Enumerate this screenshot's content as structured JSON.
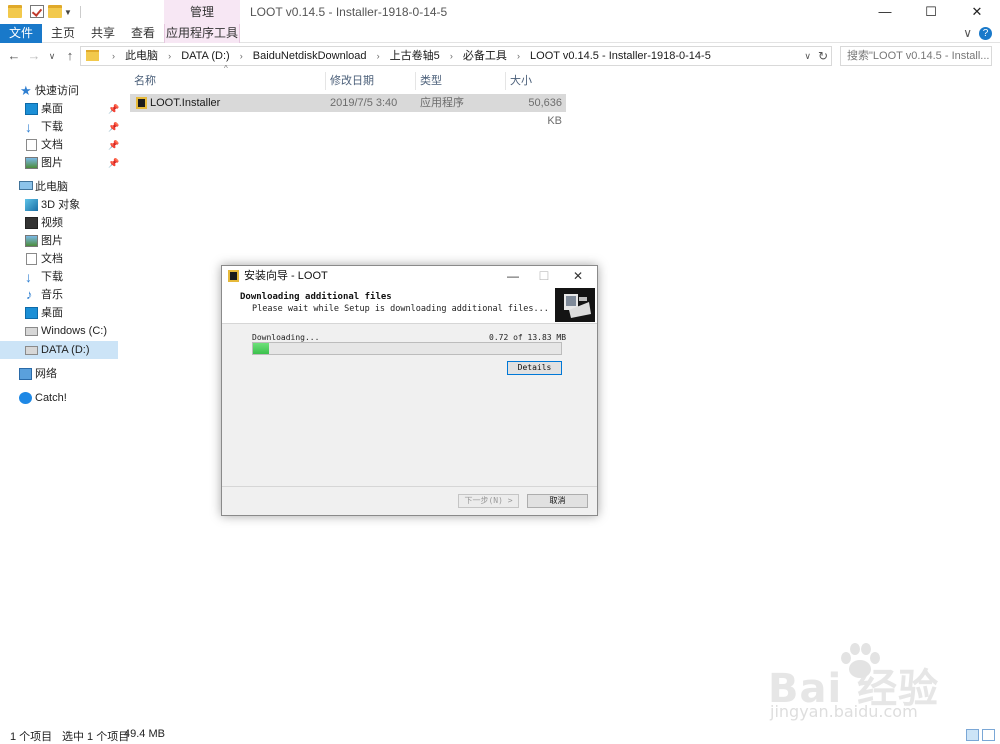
{
  "window": {
    "title": "LOOT v0.14.5 - Installer-1918-0-14-5",
    "contextual_group": "管理",
    "controls": {
      "minimize": "—",
      "maximize": "☐",
      "close": "✕"
    }
  },
  "ribbon": {
    "tabs": [
      "文件",
      "主页",
      "共享",
      "查看",
      "应用程序工具"
    ],
    "expand": "∨",
    "help": "?"
  },
  "address": {
    "crumbs": [
      "此电脑",
      "DATA (D:)",
      "BaiduNetdiskDownload",
      "上古卷轴5",
      "必备工具",
      "LOOT v0.14.5 - Installer-1918-0-14-5"
    ],
    "search_placeholder": "搜索\"LOOT v0.14.5 - Install...",
    "nav": {
      "back": "←",
      "forward": "→",
      "recent": "∨",
      "up": "↑"
    }
  },
  "sidebar": {
    "quick_access": "快速访问",
    "quick_items": [
      "桌面",
      "下载",
      "文档",
      "图片"
    ],
    "this_pc": "此电脑",
    "pc_items": [
      "3D 对象",
      "视频",
      "图片",
      "文档",
      "下载",
      "音乐",
      "桌面",
      "Windows (C:)",
      "DATA (D:)"
    ],
    "network": "网络",
    "catch": "Catch!"
  },
  "file_list": {
    "columns": [
      "名称",
      "修改日期",
      "类型",
      "大小"
    ],
    "rows": [
      {
        "name": "LOOT.Installer",
        "date": "2019/7/5 3:40",
        "type": "应用程序",
        "size": "50,636 KB"
      }
    ]
  },
  "status": {
    "count": "1 个项目",
    "selected": "选中 1 个项目",
    "size": "49.4 MB"
  },
  "dialog": {
    "title": "安装向导 - LOOT",
    "heading": "Downloading additional files",
    "subheading": "Please wait while Setup is downloading additional files...",
    "status_label": "Downloading...",
    "progress_text": "0.72 of 13.83 MB",
    "progress_fraction": 0.052,
    "details_button": "Details",
    "next_button": "下一步(N) >",
    "cancel_button": "取消",
    "controls": {
      "minimize": "—",
      "maximize": "☐",
      "close": "✕"
    }
  },
  "watermark": {
    "brand": "Bai  经验",
    "url": "jingyan.baidu.com"
  },
  "colors": {
    "accent": "#1979ca",
    "selected_row": "#d9d9d9",
    "progress": "#3cc14d"
  }
}
